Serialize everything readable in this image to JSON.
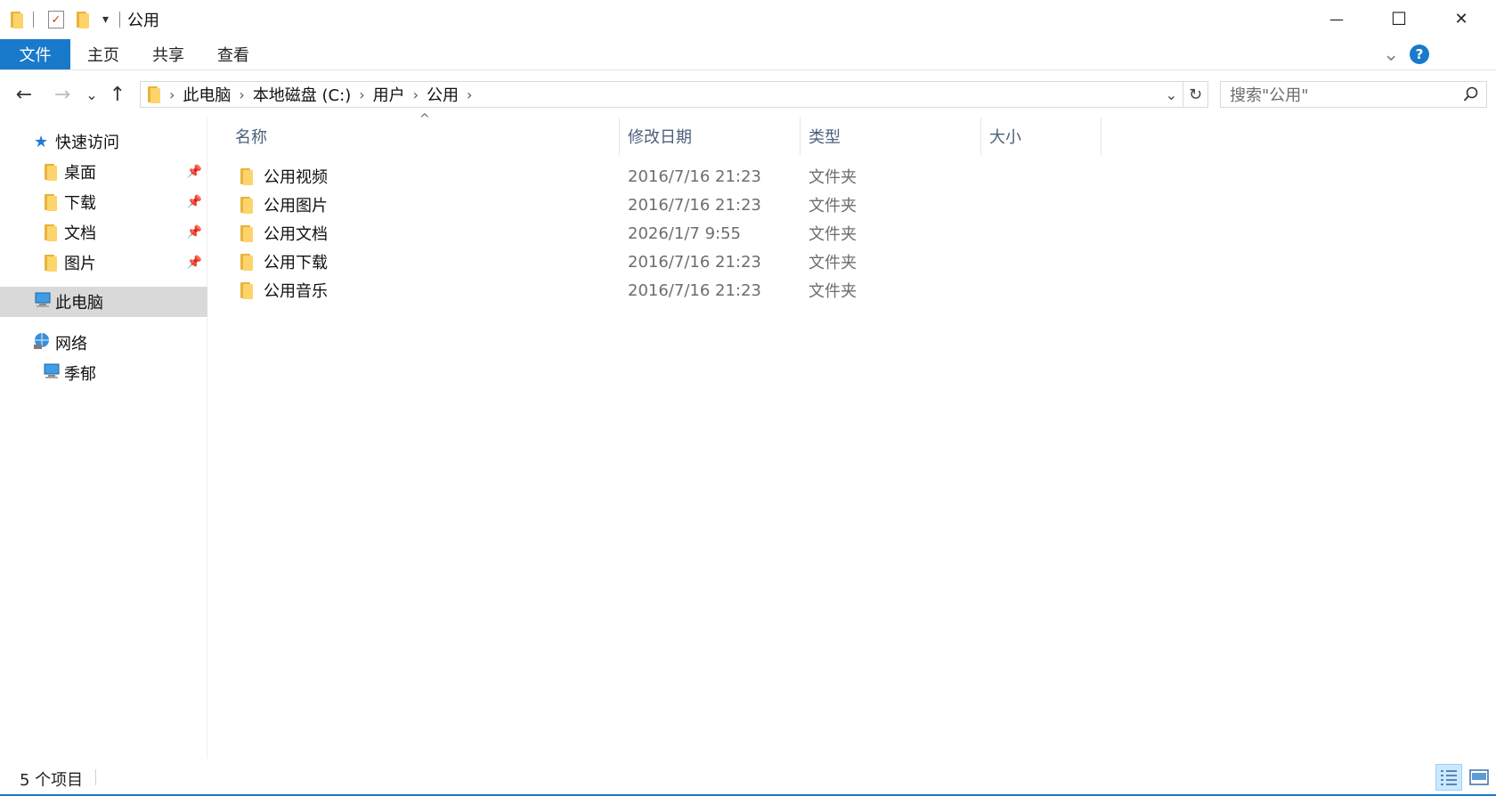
{
  "window": {
    "title": "公用",
    "qat_dropdown": "▾",
    "minimize": "—",
    "maximize": "☐",
    "close": "✕"
  },
  "ribbon": {
    "tabs": [
      {
        "label": "文件",
        "active": true
      },
      {
        "label": "主页",
        "active": false
      },
      {
        "label": "共享",
        "active": false
      },
      {
        "label": "查看",
        "active": false
      }
    ],
    "expand_glyph": "⌄",
    "help_glyph": "?"
  },
  "nav": {
    "back": "←",
    "forward": "→",
    "recent": "⌄",
    "up": "↑",
    "breadcrumb": [
      "此电脑",
      "本地磁盘 (C:)",
      "用户",
      "公用"
    ],
    "address_dropdown": "⌄",
    "refresh": "↻",
    "search_placeholder": "搜索\"公用\""
  },
  "sidebar": {
    "quick_access": "快速访问",
    "quick_items": [
      {
        "label": "桌面",
        "icon": "desktop-folder-icon"
      },
      {
        "label": "下载",
        "icon": "downloads-folder-icon"
      },
      {
        "label": "文档",
        "icon": "documents-folder-icon"
      },
      {
        "label": "图片",
        "icon": "pictures-folder-icon"
      }
    ],
    "this_pc": "此电脑",
    "network": "网络",
    "network_items": [
      {
        "label": "季郁",
        "icon": "computer-icon"
      }
    ]
  },
  "columns": {
    "name": "名称",
    "modified": "修改日期",
    "type": "类型",
    "size": "大小",
    "sort_glyph": "^"
  },
  "files": [
    {
      "name": "公用视频",
      "modified": "2016/7/16 21:23",
      "type": "文件夹",
      "size": ""
    },
    {
      "name": "公用图片",
      "modified": "2016/7/16 21:23",
      "type": "文件夹",
      "size": ""
    },
    {
      "name": "公用文档",
      "modified": "2026/1/7 9:55",
      "type": "文件夹",
      "size": ""
    },
    {
      "name": "公用下载",
      "modified": "2016/7/16 21:23",
      "type": "文件夹",
      "size": ""
    },
    {
      "name": "公用音乐",
      "modified": "2016/7/16 21:23",
      "type": "文件夹",
      "size": ""
    }
  ],
  "status": {
    "item_count": "5 个项目"
  },
  "colors": {
    "accent": "#1979ca",
    "folder": "#fcd46a",
    "selected_bg": "#d9d9d9",
    "header_text": "#4c607a"
  }
}
